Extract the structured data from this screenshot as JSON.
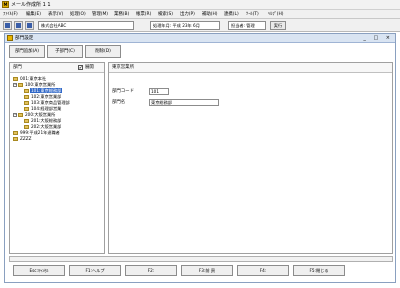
{
  "app": {
    "title": "メール作成所 1 1",
    "icon_label": "M"
  },
  "menu": [
    "ﾌｧｲﾙ(F)",
    "編集(E)",
    "表示(V)",
    "処理(O)",
    "管理(M)",
    "業務(B)",
    "帳票(R)",
    "検索(S)",
    "出力(P)",
    "補助(H)",
    "連携(L)",
    "ﾂｰﾙ(T)",
    "ﾍﾙﾌﾟ(H)"
  ],
  "toolbar": {
    "company": "株式会社ABC",
    "period": "処理年月: 平成 23年 6月",
    "user": "担当者: 管理",
    "exec_label": "実行"
  },
  "window": {
    "title": "部門設定",
    "controls": "_ □ ×"
  },
  "tabs": {
    "tab1": "部門追加(A)",
    "tab2": "子部門(C)",
    "tab3": "削除(D)"
  },
  "left_panel": {
    "header_label": "部門",
    "expand_label": "展開",
    "expand_checked": "✔"
  },
  "tree": [
    {
      "exp": "",
      "label": "001:東京本社"
    },
    {
      "exp": "−",
      "label": "100:東京営業所"
    },
    {
      "exp": "",
      "label": "101:東京総務部"
    },
    {
      "exp": "",
      "label": "102:東京営業部"
    },
    {
      "exp": "",
      "label": "103:東京商品管理部"
    },
    {
      "exp": "",
      "label": "104:経理部営業"
    },
    {
      "exp": "−",
      "label": "200:大阪営業所"
    },
    {
      "exp": "",
      "label": "201:大阪総務部"
    },
    {
      "exp": "",
      "label": "202:大阪営業部"
    },
    {
      "exp": "",
      "label": "999:平成21年退職者"
    },
    {
      "exp": "",
      "label": "ZZZZ"
    }
  ],
  "right_panel": {
    "header": "東京営業所",
    "code_label": "部門コード",
    "code_value": "101",
    "name_label": "部門名",
    "name_value": "東京総務部"
  },
  "fkeys": [
    "Esc:ｷｬﾝｾﾙ",
    "F1:ヘルプ",
    "F2:",
    "F3:前 頁",
    "F4:",
    "F5:閉じる"
  ]
}
